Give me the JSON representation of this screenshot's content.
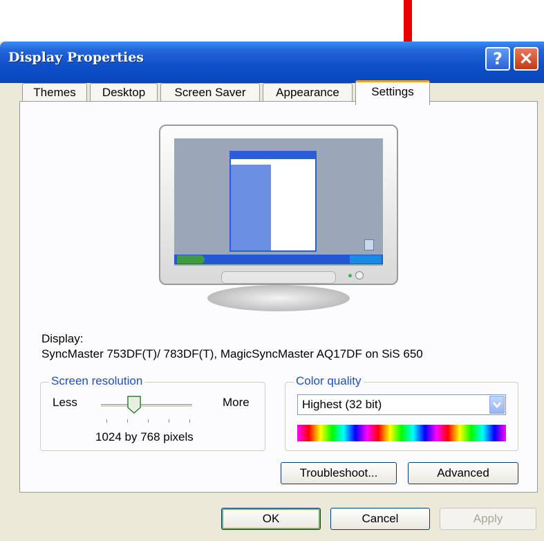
{
  "window": {
    "title": "Display Properties",
    "help_label": "?",
    "close_label": "✕"
  },
  "tabs": [
    {
      "label": "Themes"
    },
    {
      "label": "Desktop"
    },
    {
      "label": "Screen Saver"
    },
    {
      "label": "Appearance"
    },
    {
      "label": "Settings",
      "active": true
    }
  ],
  "settings": {
    "display_label": "Display:",
    "display_value": "SyncMaster 753DF(T)/ 783DF(T), MagicSyncMaster AQ17DF on SiS 650",
    "resolution": {
      "title": "Screen resolution",
      "less_label": "Less",
      "more_label": "More",
      "value_text": "1024 by 768 pixels"
    },
    "color_quality": {
      "title": "Color quality",
      "selected": "Highest (32 bit)"
    },
    "troubleshoot_label": "Troubleshoot...",
    "advanced_label": "Advanced"
  },
  "footer": {
    "ok_label": "OK",
    "cancel_label": "Cancel",
    "apply_label": "Apply"
  },
  "colors": {
    "annotation_arrow": "#e60000",
    "titlebar": "#0d4fc8",
    "active_tab_accent": "#f7a21c",
    "groupbox_title": "#1c4ec3"
  },
  "icons": [
    "help-icon",
    "close-icon",
    "dropdown-arrow-icon",
    "monitor-icon",
    "slider-thumb-icon"
  ]
}
